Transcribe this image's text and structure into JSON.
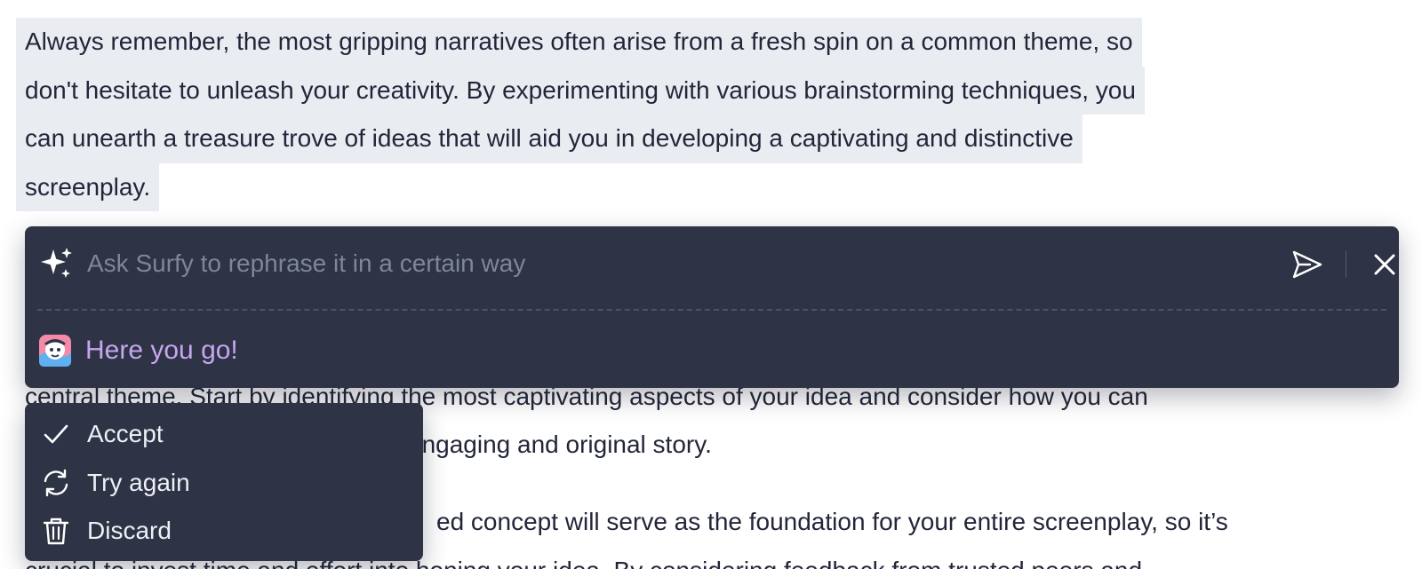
{
  "document": {
    "selected_paragraph_lines": [
      "Always remember, the most gripping narratives often arise from a fresh spin on a common theme, so",
      "don't hesitate to unleash your creativity. By experimenting with various brainstorming techniques, you",
      "can unearth a treasure trove of ideas that will aid you in developing a captivating and distinctive",
      "screenplay."
    ],
    "partial_lines": [
      "central theme. Start by identifying the most captivating aspects of your idea and consider how you can",
      "engaging and original story.",
      "ed concept will serve as the foundation for your entire screenplay, so it’s",
      "crucial to invest time and effort into honing your idea. By considering feedback from trusted peers and"
    ]
  },
  "assistant": {
    "placeholder": "Ask Surfy to rephrase it in a certain way",
    "input_value": "",
    "response": "Here you go!",
    "icons": {
      "prompt": "sparkle-icon",
      "send": "send-icon",
      "close": "close-icon",
      "avatar": "surfy-avatar"
    }
  },
  "menu": {
    "items": [
      {
        "label": "Accept",
        "icon": "checkmark-icon"
      },
      {
        "label": "Try again",
        "icon": "refresh-icon"
      },
      {
        "label": "Discard",
        "icon": "trash-icon"
      }
    ]
  },
  "colors": {
    "panel_bg": "#2e3345",
    "selection_bg": "#e9edf2",
    "response_text": "#c7a6f0",
    "body_text": "#23263a"
  }
}
